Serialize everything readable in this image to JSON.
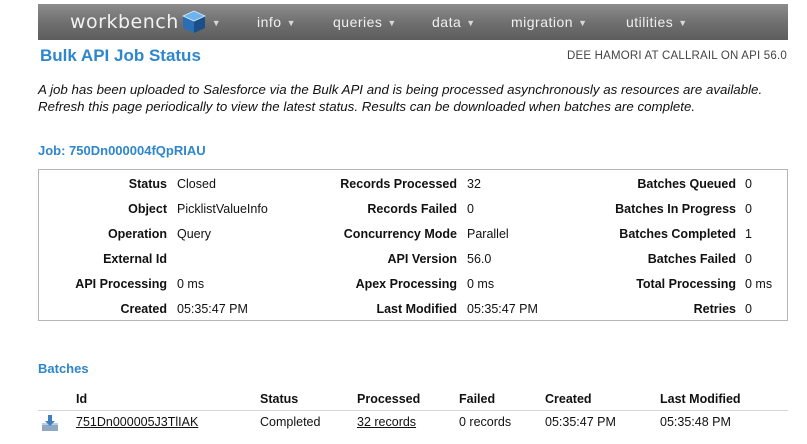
{
  "nav": {
    "brand": "workbench",
    "menus": [
      "info",
      "queries",
      "data",
      "migration",
      "utilities"
    ]
  },
  "header": {
    "title": "Bulk API Job Status",
    "user_info": "DEE HAMORI AT CALLRAIL ON API 56.0"
  },
  "description": "A job has been uploaded to Salesforce via the Bulk API and is being processed asynchronously as resources are available. Refresh this page periodically to view the latest status. Results can be downloaded when batches are complete.",
  "job": {
    "label": "Job: 750Dn000004fQpRIAU"
  },
  "status": {
    "col1": [
      {
        "label": "Status",
        "value": "Closed"
      },
      {
        "label": "Object",
        "value": "PicklistValueInfo"
      },
      {
        "label": "Operation",
        "value": "Query"
      },
      {
        "label": "External Id",
        "value": ""
      },
      {
        "label": "API Processing",
        "value": "0 ms"
      },
      {
        "label": "Created",
        "value": "05:35:47 PM"
      }
    ],
    "col2": [
      {
        "label": "Records Processed",
        "value": "32"
      },
      {
        "label": "Records Failed",
        "value": "0"
      },
      {
        "label": "Concurrency Mode",
        "value": "Parallel"
      },
      {
        "label": "API Version",
        "value": "56.0"
      },
      {
        "label": "Apex Processing",
        "value": "0 ms"
      },
      {
        "label": "Last Modified",
        "value": "05:35:47 PM"
      }
    ],
    "col3": [
      {
        "label": "Batches Queued",
        "value": "0"
      },
      {
        "label": "Batches In Progress",
        "value": "0"
      },
      {
        "label": "Batches Completed",
        "value": "1"
      },
      {
        "label": "Batches Failed",
        "value": "0"
      },
      {
        "label": "Total Processing",
        "value": "0 ms"
      },
      {
        "label": "Retries",
        "value": "0"
      }
    ]
  },
  "batches": {
    "label": "Batches",
    "headers": [
      "Id",
      "Status",
      "Processed",
      "Failed",
      "Created",
      "Last Modified"
    ],
    "rows": [
      {
        "id": "751Dn000005J3TlIAK",
        "status": "Completed",
        "processed": "32 records",
        "failed": "0 records",
        "created": "05:35:47 PM",
        "last_modified": "05:35:48 PM"
      }
    ]
  },
  "colors": {
    "accent": "#2e86cc",
    "nav_bg": "#6e6e6e",
    "cube": "#2a6fb5"
  },
  "icons": [
    "cube-logo-icon",
    "chevron-down-icon",
    "download-icon"
  ]
}
